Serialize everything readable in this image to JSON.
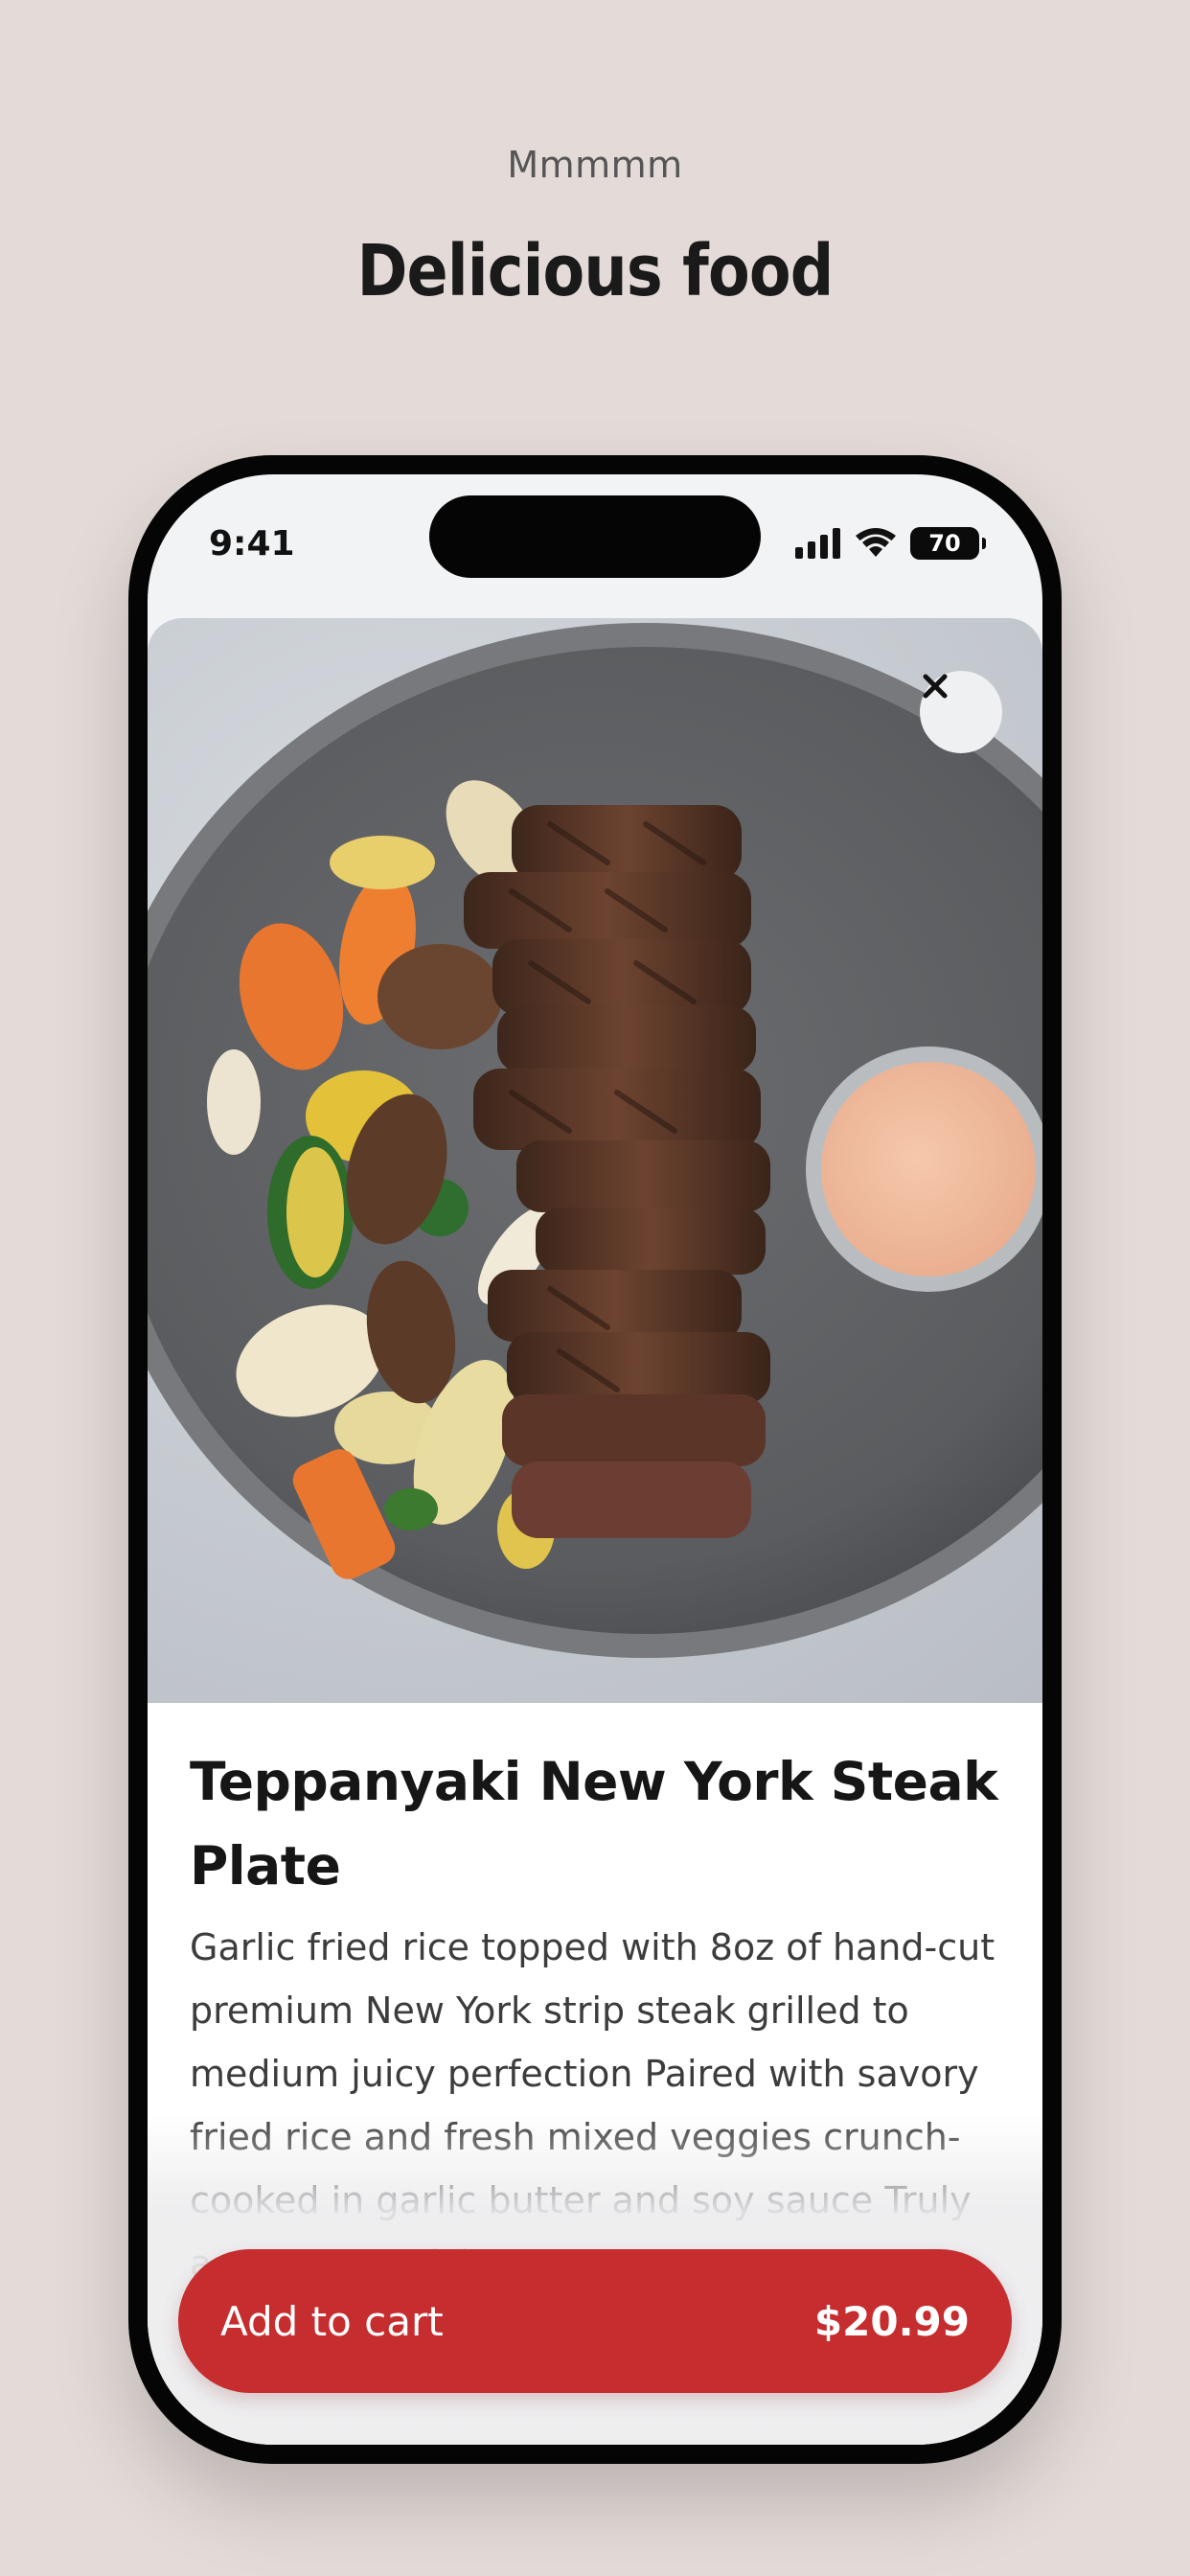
{
  "header": {
    "eyebrow": "Mmmmm",
    "title": "Delicious food"
  },
  "status_bar": {
    "time": "9:41",
    "battery": "70"
  },
  "product": {
    "title": "Teppanyaki New York Steak Plate",
    "description": "Garlic fried rice topped with 8oz of hand-cut premium New York strip steak grilled to medium juicy perfection Paired with savory fried rice and fresh mixed veggies crunch-cooked in garlic butter and soy sauce Truly a customer pick"
  },
  "cart": {
    "label": "Add to cart",
    "price": "$20.99"
  },
  "colors": {
    "background": "#e4dbd8",
    "accent": "#c62d2f"
  },
  "icons": {
    "close": "close-icon",
    "signal": "cellular-signal-icon",
    "wifi": "wifi-icon",
    "battery": "battery-icon"
  }
}
